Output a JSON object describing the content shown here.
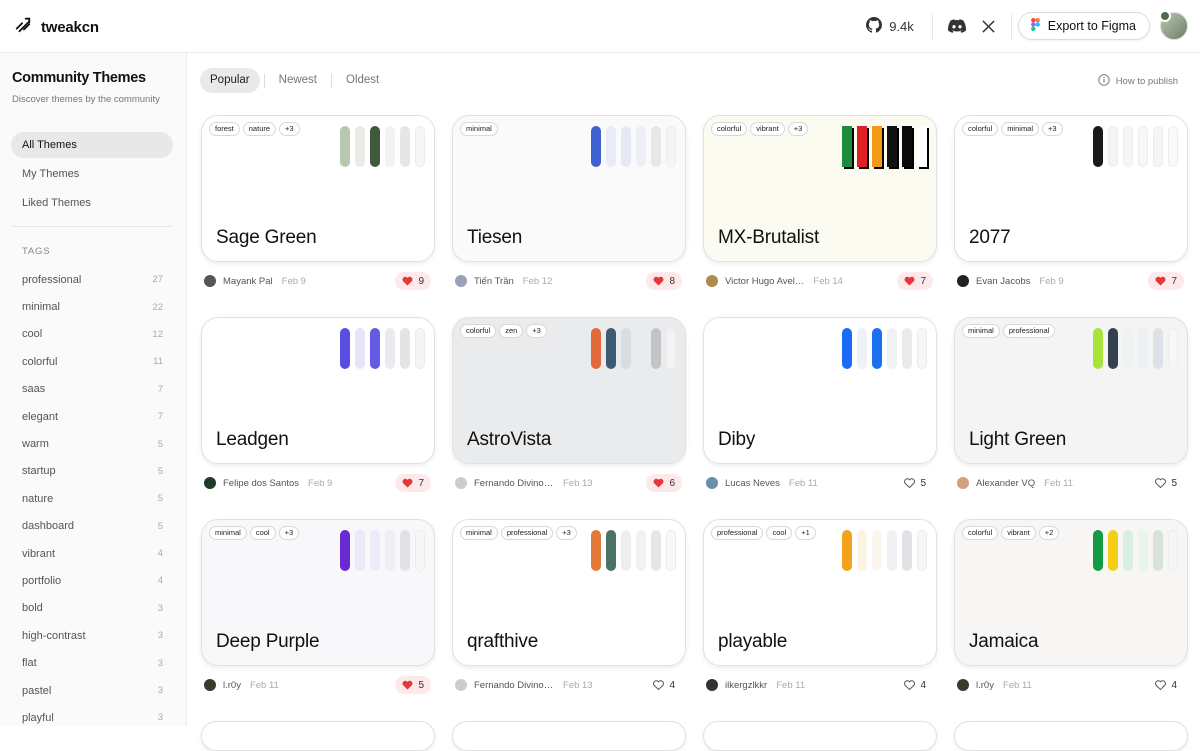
{
  "header": {
    "brand": "tweakcn",
    "github_stars": "9.4k",
    "export_label": "Export to Figma"
  },
  "sidebar": {
    "title": "Community Themes",
    "subtitle": "Discover themes by the community",
    "nav": [
      "All Themes",
      "My Themes",
      "Liked Themes"
    ],
    "tags_heading": "TAGS",
    "tags": [
      {
        "name": "professional",
        "count": "27"
      },
      {
        "name": "minimal",
        "count": "22"
      },
      {
        "name": "cool",
        "count": "12"
      },
      {
        "name": "colorful",
        "count": "11"
      },
      {
        "name": "saas",
        "count": "7"
      },
      {
        "name": "elegant",
        "count": "7"
      },
      {
        "name": "warm",
        "count": "5"
      },
      {
        "name": "startup",
        "count": "5"
      },
      {
        "name": "nature",
        "count": "5"
      },
      {
        "name": "dashboard",
        "count": "5"
      },
      {
        "name": "vibrant",
        "count": "4"
      },
      {
        "name": "portfolio",
        "count": "4"
      },
      {
        "name": "bold",
        "count": "3"
      },
      {
        "name": "high-contrast",
        "count": "3"
      },
      {
        "name": "flat",
        "count": "3"
      },
      {
        "name": "pastel",
        "count": "3"
      },
      {
        "name": "playful",
        "count": "3"
      }
    ]
  },
  "sort": {
    "options": [
      "Popular",
      "Newest",
      "Oldest"
    ],
    "active": "Popular",
    "how_to_publish": "How to publish"
  },
  "themes": [
    {
      "name": "Sage Green",
      "bg": "#ffffff",
      "tags": [
        "forest",
        "nature",
        "+3"
      ],
      "swatches": [
        "#b8c7b0",
        "#e9ece7",
        "#3f5a3a",
        "#f1f3f0",
        "#e4e7e3",
        "#f7f8f6"
      ],
      "author": "Mayank Pal",
      "avatar_color": "#555555",
      "date": "Feb 9",
      "likes": "9",
      "liked": true
    },
    {
      "name": "Tiesen",
      "bg": "#fafafa",
      "tags": [
        "minimal"
      ],
      "swatches": [
        "#3f62d1",
        "#e8ecf6",
        "#e6e9f3",
        "#eef0f6",
        "#e7e7e7",
        "#f5f5f5"
      ],
      "author": "Tiến Trần",
      "avatar_color": "#9aa0b5",
      "date": "Feb 12",
      "likes": "8",
      "liked": true
    },
    {
      "name": "MX-Brutalist",
      "bg": "#fcfbf1",
      "tags": [
        "colorful",
        "vibrant",
        "+3"
      ],
      "swatches": [
        "#1e8a3c",
        "#e12025",
        "#f39a17",
        "#111111",
        "#0a0a0a",
        "#ffffff"
      ],
      "author": "Victor Hugo Avel…",
      "avatar_color": "#b08a4a",
      "date": "Feb 14",
      "likes": "7",
      "liked": true
    },
    {
      "name": "2077",
      "bg": "#ffffff",
      "tags": [
        "colorful",
        "minimal",
        "+3"
      ],
      "swatches": [
        "#1a1a1a",
        "#f4f4f4",
        "#f6f6f6",
        "#f7f7f7",
        "#f5f5f5",
        "#fafafa"
      ],
      "author": "Evan Jacobs",
      "avatar_color": "#222222",
      "date": "Feb 9",
      "likes": "7",
      "liked": true
    },
    {
      "name": "Leadgen",
      "bg": "#ffffff",
      "tags": [],
      "swatches": [
        "#5a4ee0",
        "#e6e4f9",
        "#6659e6",
        "#ebebef",
        "#e4e4e4",
        "#f5f5f5"
      ],
      "author": "Felipe dos Santos",
      "avatar_color": "#1e3a28",
      "date": "Feb 9",
      "likes": "7",
      "liked": true
    },
    {
      "name": "AstroVista",
      "bg": "#eaebed",
      "tags": [
        "colorful",
        "zen",
        "+3"
      ],
      "swatches": [
        "#e2693a",
        "#3d5a73",
        "#d8dde3",
        "#e9ecef",
        "#c2c4c7",
        "#f3f3f3"
      ],
      "author": "Fernando Divino …",
      "avatar_color": "#cccccc",
      "date": "Feb 13",
      "likes": "6",
      "liked": true
    },
    {
      "name": "Diby",
      "bg": "#ffffff",
      "tags": [],
      "swatches": [
        "#1a6cf5",
        "#eef2f8",
        "#1b70f0",
        "#f0f2f6",
        "#eaeaea",
        "#f7f7f7"
      ],
      "author": "Lucas Neves",
      "avatar_color": "#6a8fa8",
      "date": "Feb 11",
      "likes": "5",
      "liked": false
    },
    {
      "name": "Light Green",
      "bg": "#f4f4f4",
      "tags": [
        "minimal",
        "professional"
      ],
      "swatches": [
        "#a8e33c",
        "#34424f",
        "#eef2ee",
        "#edf0f3",
        "#dde2e8",
        "#f6f7f8"
      ],
      "author": "Alexander VQ",
      "avatar_color": "#d4a07a",
      "date": "Feb 11",
      "likes": "5",
      "liked": false
    },
    {
      "name": "Deep Purple",
      "bg": "#f8f8fa",
      "tags": [
        "minimal",
        "cool",
        "+3"
      ],
      "swatches": [
        "#6a2ad3",
        "#ede8f6",
        "#efeaf8",
        "#eeeef3",
        "#e0e0e6",
        "#f7f7f9"
      ],
      "author": "l.r0y",
      "avatar_color": "#3a3a2a",
      "date": "Feb 11",
      "likes": "5",
      "liked": true
    },
    {
      "name": "qrafthive",
      "bg": "#ffffff",
      "tags": [
        "minimal",
        "professional",
        "+3"
      ],
      "swatches": [
        "#e2793a",
        "#4a7265",
        "#eeeeee",
        "#f2f2f2",
        "#e6e6e6",
        "#f9f9f9"
      ],
      "author": "Fernando Divino …",
      "avatar_color": "#cccccc",
      "date": "Feb 13",
      "likes": "4",
      "liked": false
    },
    {
      "name": "playable",
      "bg": "#ffffff",
      "tags": [
        "professional",
        "cool",
        "+1"
      ],
      "swatches": [
        "#f2a21b",
        "#fbf3e4",
        "#fbf7ee",
        "#f1f1f4",
        "#e1e2e6",
        "#f7f7f9"
      ],
      "author": "ilkergzlkkr",
      "avatar_color": "#333333",
      "date": "Feb 11",
      "likes": "4",
      "liked": false
    },
    {
      "name": "Jamaica",
      "bg": "#f7f6f4",
      "tags": [
        "colorful",
        "vibrant",
        "+2"
      ],
      "swatches": [
        "#139a43",
        "#f5cf14",
        "#d7f0e0",
        "#e9f4ec",
        "#d8e2da",
        "#f6f6f4"
      ],
      "author": "l.r0y",
      "avatar_color": "#3a3a2a",
      "date": "Feb 11",
      "likes": "4",
      "liked": false
    }
  ]
}
